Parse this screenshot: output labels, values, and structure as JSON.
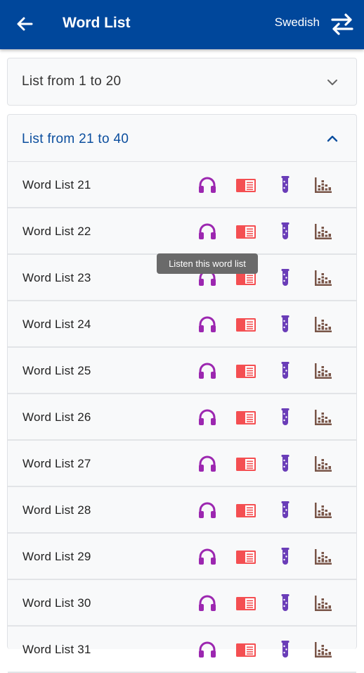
{
  "app_bar": {
    "title": "Word List",
    "language": "Swedish",
    "back_icon": "arrow-left-icon",
    "swap_icon": "swap-arrows-icon",
    "background_color": "#00479b"
  },
  "sections": {
    "collapsed": {
      "label": "List from 1 to 20",
      "icon": "chevron-down-icon"
    },
    "expanded": {
      "label": "List from 21 to 40",
      "icon": "chevron-up-icon",
      "label_color": "#0b4e9e"
    }
  },
  "word_lists": [
    {
      "label": "Word List 21"
    },
    {
      "label": "Word List 22"
    },
    {
      "label": "Word List 23"
    },
    {
      "label": "Word List 24"
    },
    {
      "label": "Word List 25"
    },
    {
      "label": "Word List 26"
    },
    {
      "label": "Word List 27"
    },
    {
      "label": "Word List 28"
    },
    {
      "label": "Word List 29"
    },
    {
      "label": "Word List 30"
    },
    {
      "label": "Word List 31"
    }
  ],
  "row_actions": {
    "listen_icon": "headphones-icon",
    "read_icon": "book-icon",
    "test_icon": "test-tube-icon",
    "stats_icon": "bar-chart-icon",
    "colors": {
      "listen": "#9c27b0",
      "read": "#f44f52",
      "test": "#6a3db8",
      "stats": "#795548"
    }
  },
  "tooltip": {
    "text": "Listen this word list"
  }
}
